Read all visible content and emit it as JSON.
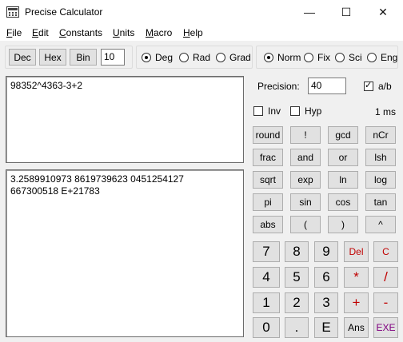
{
  "window": {
    "title": "Precise Calculator",
    "icons": {
      "app": "calculator-icon",
      "minimize": "minimize-icon",
      "maximize": "maximize-icon",
      "close": "close-icon"
    },
    "minimize": "—",
    "maximize": "☐",
    "close": "✕"
  },
  "menu": {
    "items": [
      {
        "label": "File",
        "key": "F",
        "rest": "ile"
      },
      {
        "label": "Edit",
        "key": "E",
        "rest": "dit"
      },
      {
        "label": "Constants",
        "key": "C",
        "rest": "onstants"
      },
      {
        "label": "Units",
        "key": "U",
        "rest": "nits"
      },
      {
        "label": "Macro",
        "key": "M",
        "rest": "acro"
      },
      {
        "label": "Help",
        "key": "H",
        "rest": "elp"
      }
    ]
  },
  "base": {
    "dec": "Dec",
    "hex": "Hex",
    "bin": "Bin",
    "value": "10"
  },
  "angle": {
    "deg": "Deg",
    "rad": "Rad",
    "grad": "Grad",
    "selected": "Deg"
  },
  "notation": {
    "norm": "Norm",
    "fix": "Fix",
    "sci": "Sci",
    "eng": "Eng",
    "selected": "Norm"
  },
  "input": {
    "expression": "98352^4363-3+2"
  },
  "output": {
    "line1": "3.2589910973 8619739623 0451254127",
    "line2": "667300518 E+21783"
  },
  "precision": {
    "label": "Precision:",
    "value": "40"
  },
  "fraction": {
    "label": "a/b",
    "checked": true
  },
  "inv": {
    "label": "Inv",
    "checked": false
  },
  "hyp": {
    "label": "Hyp",
    "checked": false
  },
  "timing": "1 ms",
  "functions": [
    [
      "round",
      "!",
      "gcd",
      "nCr"
    ],
    [
      "frac",
      "and",
      "or",
      "lsh"
    ],
    [
      "sqrt",
      "exp",
      "ln",
      "log"
    ],
    [
      "pi",
      "sin",
      "cos",
      "tan"
    ],
    [
      "abs",
      "(",
      ")",
      "^"
    ]
  ],
  "keypad": [
    [
      "7",
      "8",
      "9",
      "Del",
      "C"
    ],
    [
      "4",
      "5",
      "6",
      "*",
      "/"
    ],
    [
      "1",
      "2",
      "3",
      "+",
      "-"
    ],
    [
      "0",
      ".",
      "E",
      "Ans",
      "EXE"
    ]
  ],
  "colors": {
    "red_keys": "#c00000",
    "exe_key": "#800080"
  }
}
